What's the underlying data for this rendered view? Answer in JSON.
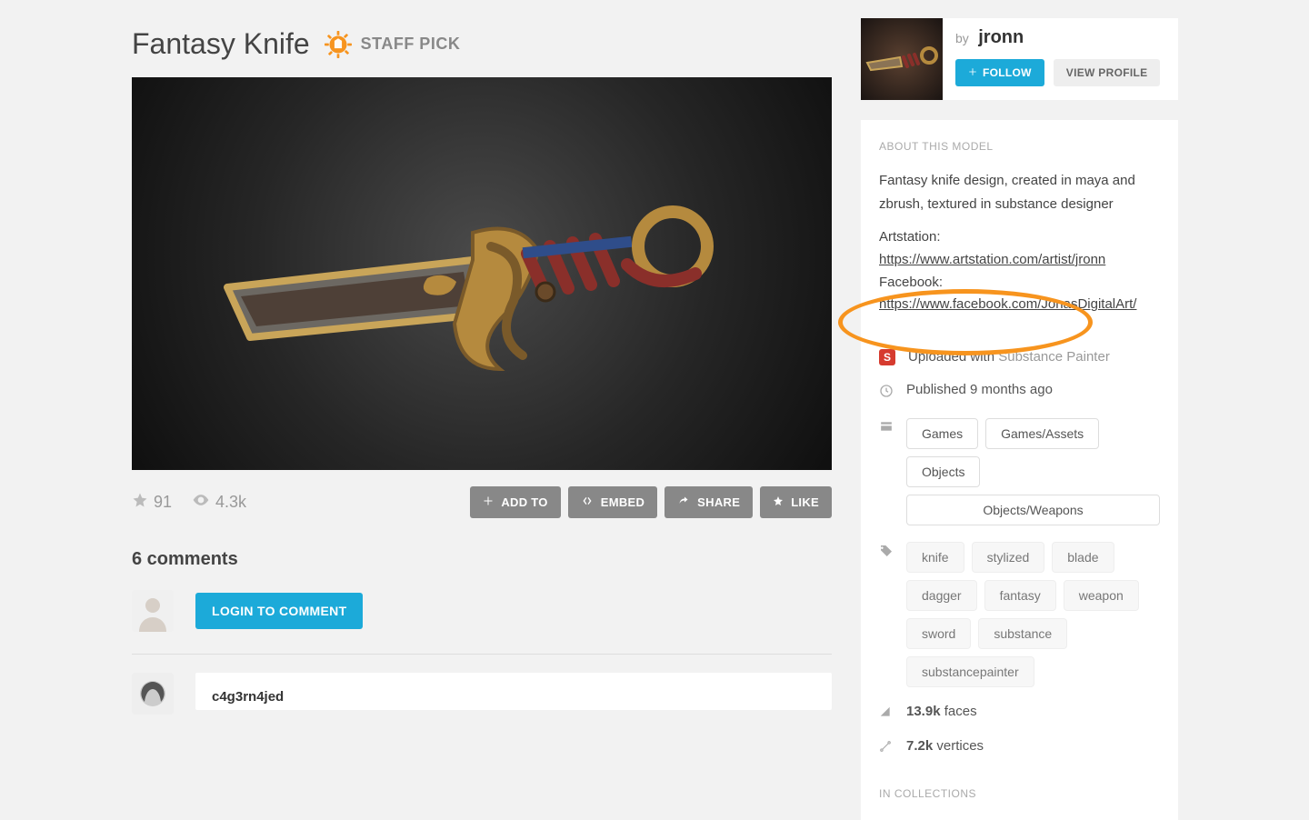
{
  "title": "Fantasy Knife",
  "staff_pick": "STAFF PICK",
  "stats": {
    "likes": "91",
    "views": "4.3k"
  },
  "actions": {
    "add_to": "ADD TO",
    "embed": "EMBED",
    "share": "SHARE",
    "like": "LIKE"
  },
  "comments": {
    "heading": "6 comments",
    "login_btn": "LOGIN TO COMMENT",
    "first_user": "c4g3rn4jed"
  },
  "author": {
    "by": "by",
    "name": "jronn",
    "follow": "FOLLOW",
    "view_profile": "VIEW PROFILE"
  },
  "about": {
    "title": "ABOUT THIS MODEL",
    "description": "Fantasy knife design, created in maya and zbrush, textured in substance designer",
    "artstation_label": "Artstation:",
    "artstation_url": "https://www.artstation.com/artist/jronn",
    "facebook_label": "Facebook:",
    "facebook_url": "https://www.facebook.com/JonasDigitalArt/",
    "uploaded_with_label": "Uploaded with",
    "uploaded_with_tool": "Substance Painter",
    "published": "Published 9 months ago",
    "categories": [
      "Games",
      "Games/Assets",
      "Objects",
      "Objects/Weapons"
    ],
    "tags": [
      "knife",
      "stylized",
      "blade",
      "dagger",
      "fantasy",
      "weapon",
      "sword",
      "substance",
      "substancepainter"
    ],
    "faces_count": "13.9k",
    "faces_label": "faces",
    "vertices_count": "7.2k",
    "vertices_label": "vertices",
    "collections_title": "IN COLLECTIONS"
  }
}
